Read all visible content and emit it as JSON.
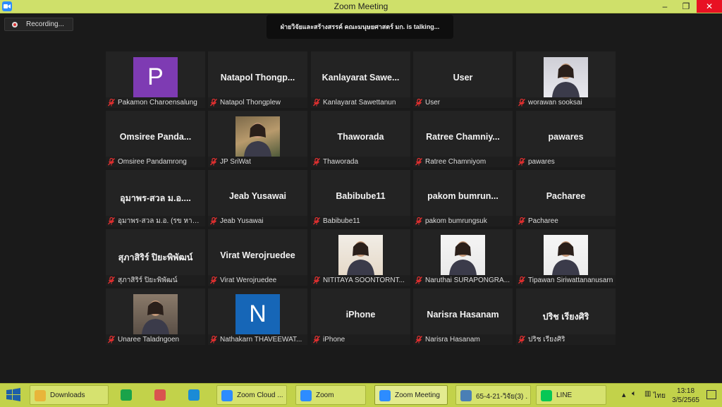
{
  "window": {
    "title": "Zoom Meeting",
    "minimize": "–",
    "restore": "❐",
    "close": "✕"
  },
  "recording": {
    "label": "Recording..."
  },
  "talking": {
    "text": "ฝ่ายวิจัยและสร้างสรรค์ คณะมนุษยศาสตร์ มก. is  talking..."
  },
  "tiles": [
    {
      "name": "",
      "avatar_letter": "P",
      "footer": "Pakamon Charoensalung"
    },
    {
      "name": "Natapol  Thongp...",
      "footer": "Natapol Thongplew"
    },
    {
      "name": "Kanlayarat  Sawe...",
      "footer": "Kanlayarat Sawettanun"
    },
    {
      "name": "User",
      "footer": "User"
    },
    {
      "name": "",
      "photo": "woman-long-hair",
      "footer": "worawan sooksai"
    },
    {
      "name": "Omsiree  Panda...",
      "footer": "Omsiree Pandamrong"
    },
    {
      "name": "",
      "photo": "woman-yellow-flowers",
      "footer": "JP SriWat"
    },
    {
      "name": "Thaworada",
      "footer": "Thaworada"
    },
    {
      "name": "Ratree  Chamniy...",
      "footer": "Ratree Chamniyom"
    },
    {
      "name": "pawares",
      "footer": "pawares"
    },
    {
      "name": "อุมาพร-สวล ม.อ....",
      "footer": "อุมาพร-สวล ม.อ. (รข หาดให..."
    },
    {
      "name": "Jeab Yusawai",
      "footer": "Jeab Yusawai"
    },
    {
      "name": "Babibube11",
      "footer": "Babibube11"
    },
    {
      "name": "pakom  bumrun...",
      "footer": "pakom bumrungsuk"
    },
    {
      "name": "Pacharee",
      "footer": "Pacharee"
    },
    {
      "name": "สุภาสิริร์ ปิยะพิพัฒน์",
      "footer": "สุภาสิริร์ ปิยะพิพัฒน์"
    },
    {
      "name": "Virat Werojruedee",
      "footer": "Virat Werojruedee"
    },
    {
      "name": "",
      "photo": "woman-flowers-room",
      "footer": "NITITAYA SOONTORNT..."
    },
    {
      "name": "",
      "photo": "woman-glasses-desk",
      "footer": "Naruthai SURAPONGRA..."
    },
    {
      "name": "",
      "photo": "woman-glasses-suit",
      "footer": "Tipawan Siriwattananusarn"
    },
    {
      "name": "",
      "photo": "woman-standing",
      "footer": "Unaree Taladngoen"
    },
    {
      "name": "",
      "avatar_letter": "N",
      "footer": "Nathakarn THAVEEWAT..."
    },
    {
      "name": "iPhone",
      "footer": "iPhone"
    },
    {
      "name": "Narisra Hasanam",
      "footer": "Narisra Hasanam"
    },
    {
      "name": "ปริช เรียงศิริ",
      "footer": "ปริช เรียงศิริ"
    }
  ],
  "taskbar": {
    "items": [
      {
        "label": "Downloads",
        "icon": "folder-icon",
        "color": "#e8b53a"
      },
      {
        "label": "",
        "icon": "store-icon",
        "color": "#1aa34a"
      },
      {
        "label": "",
        "icon": "paint-icon",
        "color": "#d9534f"
      },
      {
        "label": "",
        "icon": "edge-icon",
        "color": "#1b8bd6"
      },
      {
        "label": "Zoom Cloud ...",
        "icon": "zoom-icon",
        "color": "#2d8cff"
      },
      {
        "label": "Zoom",
        "icon": "zoom-icon",
        "color": "#2d8cff"
      },
      {
        "label": "Zoom Meeting",
        "icon": "zoom-icon",
        "color": "#2d8cff"
      },
      {
        "label": "65-4-21-วิจัย(3) ...",
        "icon": "photos-icon",
        "color": "#4a7fb5"
      },
      {
        "label": "LINE",
        "icon": "line-icon",
        "color": "#06c755"
      }
    ],
    "language": "ไทย",
    "time": "13:18",
    "date": "3/5/2565"
  },
  "colors": {
    "titlebar": "#cfe06a",
    "taskbar": "#c2d24a",
    "tile": "#232323",
    "muted_mic": "#e03030"
  }
}
